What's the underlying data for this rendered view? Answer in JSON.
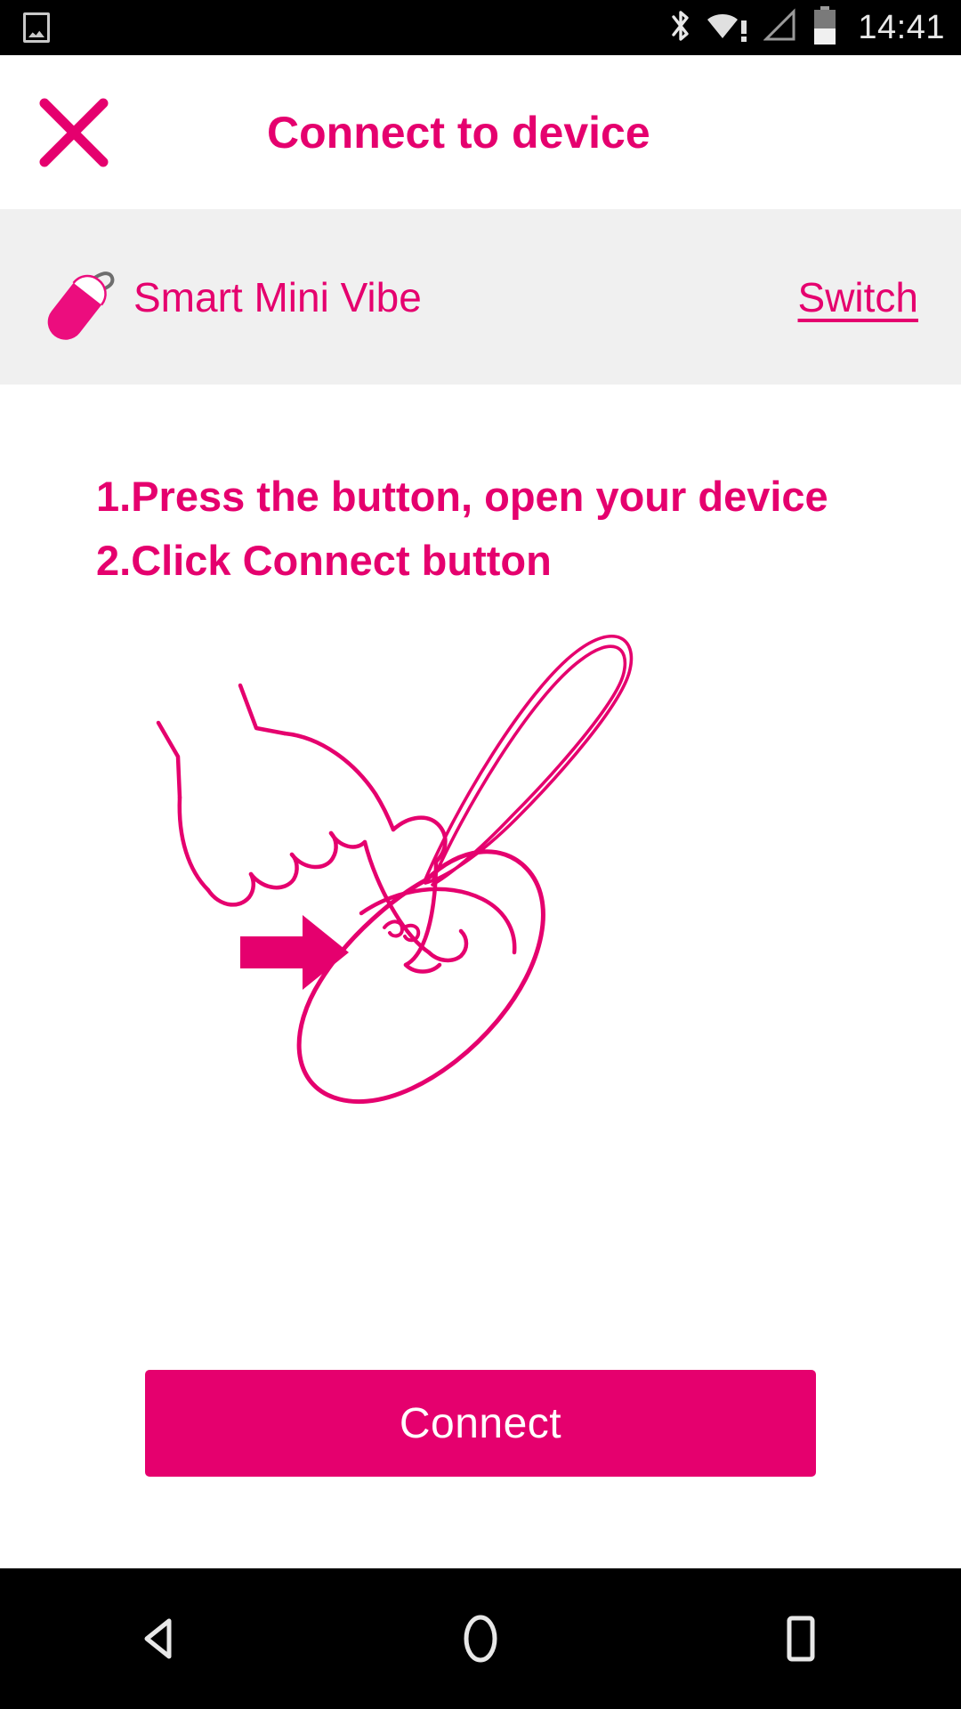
{
  "status_bar": {
    "icons": [
      {
        "name": "photo-icon",
        "label": "image"
      },
      {
        "name": "bluetooth-icon",
        "label": "bluetooth"
      },
      {
        "name": "wifi-warning-icon",
        "label": "wifi-no-internet"
      },
      {
        "name": "signal-icon",
        "label": "cellular-signal-none"
      },
      {
        "name": "battery-icon",
        "label": "battery-half"
      }
    ],
    "time": "14:41"
  },
  "header": {
    "close_icon": "close-icon",
    "title": "Connect to device"
  },
  "device": {
    "icon": "vibrator-egg-icon",
    "name": "Smart Mini Vibe",
    "switch_label": "Switch"
  },
  "instructions": {
    "line1": "1.Press the button, open your device",
    "line2": "2.Click Connect button"
  },
  "illustration": {
    "name": "hand-pressing-device-diagram",
    "arrow": "right-arrow-icon"
  },
  "actions": {
    "connect_label": "Connect"
  },
  "nav_bar": {
    "back": "back-triangle-icon",
    "home": "home-circle-icon",
    "recents": "recents-square-icon"
  },
  "colors": {
    "accent_pink": "#E5006E",
    "row_gray": "#F0F0F0",
    "status_black": "#000000",
    "white": "#FFFFFF"
  }
}
